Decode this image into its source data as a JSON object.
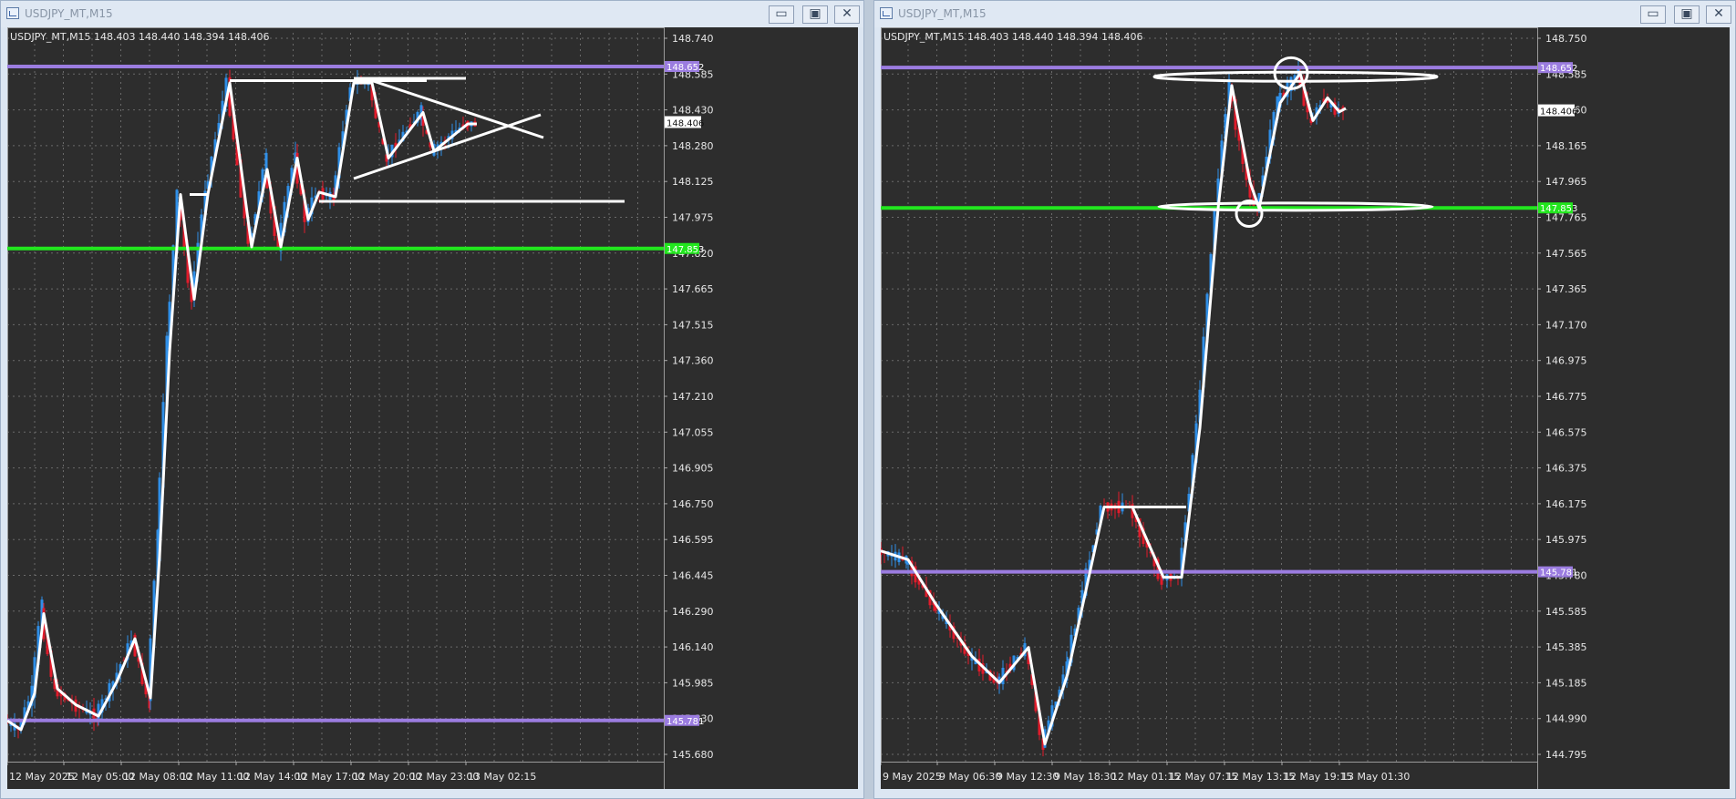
{
  "windows": [
    {
      "id": "left",
      "title": "USDJPY_MT,M15",
      "buttons": {
        "minimize": "▭",
        "maximize": "▣",
        "close": "✕"
      },
      "chart_data": {
        "type": "candlestick",
        "symbol": "USDJPY_MT,M15",
        "ohlc": "148.403 148.440 148.394 148.406",
        "y_ticks": [
          "148.740",
          "148.585",
          "148.430",
          "148.280",
          "148.125",
          "147.975",
          "147.820",
          "147.665",
          "147.515",
          "147.360",
          "147.210",
          "147.055",
          "146.905",
          "146.750",
          "146.595",
          "146.445",
          "146.290",
          "146.140",
          "145.985",
          "145.830",
          "145.680"
        ],
        "x_ticks": [
          "12 May 2025",
          "12 May 05:00",
          "12 May 08:00",
          "12 May 11:00",
          "12 May 14:00",
          "12 May 17:00",
          "12 May 20:00",
          "12 May 23:00",
          "13 May 02:15"
        ],
        "levels": [
          {
            "label": "148.652",
            "value": 148.652,
            "color": "#9b7ce0"
          },
          {
            "label": "147.853",
            "value": 147.853,
            "color": "#22e61e"
          },
          {
            "label": "145.781",
            "value": 145.781,
            "color": "#9b7ce0"
          }
        ],
        "current_price": "148.406",
        "ylim": [
          145.6,
          148.8
        ],
        "colors": {
          "up": "#2f8fe8",
          "down": "#e21b2b",
          "drawing": "#ffffff"
        }
      }
    },
    {
      "id": "right",
      "title": "USDJPY_MT,M15",
      "buttons": {
        "minimize": "▭",
        "maximize": "▣",
        "close": "✕"
      },
      "chart_data": {
        "type": "candlestick",
        "symbol": "USDJPY_MT,M15",
        "ohlc": "148.403 148.440 148.394 148.406",
        "y_ticks": [
          "148.750",
          "148.585",
          "148.360",
          "148.165",
          "147.965",
          "147.765",
          "147.565",
          "147.365",
          "147.170",
          "146.975",
          "146.775",
          "146.575",
          "146.375",
          "146.175",
          "145.975",
          "145.780",
          "145.585",
          "145.385",
          "145.185",
          "144.990",
          "144.795"
        ],
        "x_ticks": [
          "9 May 2025",
          "9 May 06:30",
          "9 May 12:30",
          "9 May 18:30",
          "12 May 01:15",
          "12 May 07:15",
          "12 May 13:15",
          "12 May 19:15",
          "13 May 01:30"
        ],
        "levels": [
          {
            "label": "148.652",
            "value": 148.652,
            "color": "#9b7ce0"
          },
          {
            "label": "147.853",
            "value": 147.853,
            "color": "#22e61e"
          },
          {
            "label": "145.781",
            "value": 145.781,
            "color": "#9b7ce0"
          }
        ],
        "current_price": "148.406",
        "ylim": [
          144.7,
          148.85
        ],
        "colors": {
          "up": "#2f8fe8",
          "down": "#e21b2b",
          "drawing": "#ffffff"
        }
      }
    }
  ]
}
